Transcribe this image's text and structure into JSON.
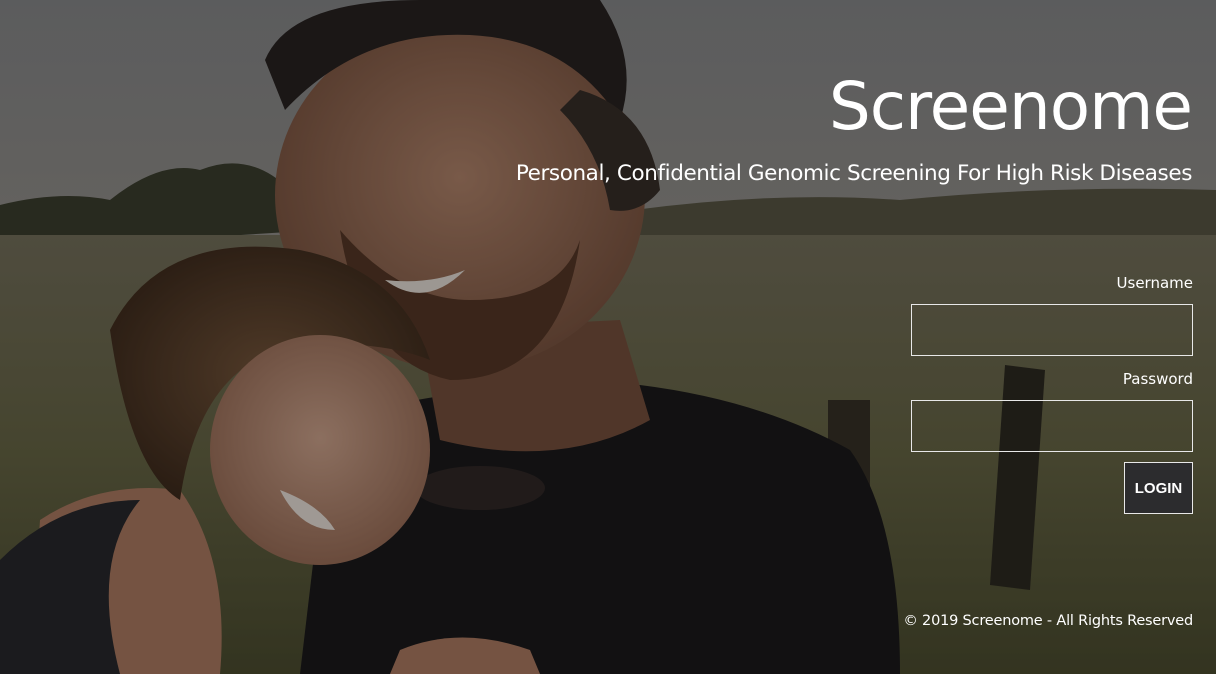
{
  "brand": {
    "title": "Screenome",
    "tagline": "Personal, Confidential Genomic Screening For High Risk Diseases"
  },
  "login": {
    "username_label": "Username",
    "username_value": "",
    "password_label": "Password",
    "password_value": "",
    "button_label": "LOGIN"
  },
  "footer": {
    "copyright": "© 2019 Screenome - All Rights Reserved"
  },
  "background": {
    "description_icon": "photo-background",
    "overlay_color": "#000000"
  }
}
